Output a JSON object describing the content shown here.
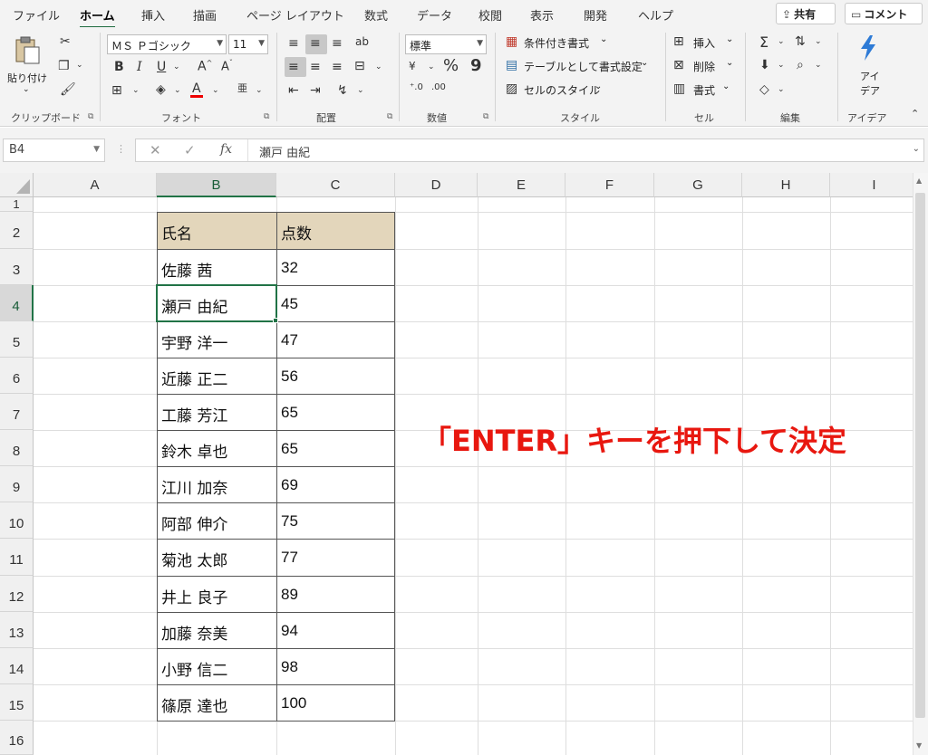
{
  "menu": {
    "tabs": [
      "ファイル",
      "ホーム",
      "挿入",
      "描画",
      "ページ レイアウト",
      "数式",
      "データ",
      "校閲",
      "表示",
      "開発",
      "ヘルプ"
    ],
    "active_tab": "ホーム",
    "share_label": "共有",
    "comment_label": "コメント"
  },
  "ribbon": {
    "clipboard": {
      "paste_label": "貼り付け",
      "group_label": "クリップボード"
    },
    "font": {
      "font_name": "ＭＳ Ｐゴシック",
      "font_size": "11",
      "group_label": "フォント",
      "bold": "B",
      "italic": "I",
      "underline": "U"
    },
    "alignment": {
      "group_label": "配置"
    },
    "number": {
      "format": "標準",
      "group_label": "数値",
      "percent": "%",
      "comma": "9"
    },
    "styles": {
      "conditional": "条件付き書式",
      "as_table": "テーブルとして書式設定",
      "cell_styles": "セルのスタイル",
      "group_label": "スタイル"
    },
    "cells": {
      "insert": "挿入",
      "delete": "削除",
      "format": "書式",
      "group_label": "セル"
    },
    "editing": {
      "group_label": "編集"
    },
    "ideas": {
      "label_line1": "アイ",
      "label_line2": "デア",
      "group_label": "アイデア"
    }
  },
  "formula_bar": {
    "name_box": "B4",
    "fx_label": "fx",
    "content": "瀬戸 由紀"
  },
  "sheet": {
    "columns": [
      "A",
      "B",
      "C",
      "D",
      "E",
      "F",
      "G",
      "H",
      "I"
    ],
    "rows": [
      "1",
      "2",
      "3",
      "4",
      "5",
      "6",
      "7",
      "8",
      "9",
      "10",
      "11",
      "12",
      "13",
      "14",
      "15",
      "16"
    ],
    "selected_column": "B",
    "selected_row": "4",
    "active_cell": "B4",
    "table": {
      "header": [
        "氏名",
        "点数"
      ],
      "rows": [
        [
          "佐藤 茜",
          "32"
        ],
        [
          "瀬戸 由紀",
          "45"
        ],
        [
          "宇野 洋一",
          "47"
        ],
        [
          "近藤 正二",
          "56"
        ],
        [
          "工藤 芳江",
          "65"
        ],
        [
          "鈴木 卓也",
          "65"
        ],
        [
          "江川 加奈",
          "69"
        ],
        [
          "阿部 伸介",
          "75"
        ],
        [
          "菊池 太郎",
          "77"
        ],
        [
          "井上 良子",
          "89"
        ],
        [
          "加藤 奈美",
          "94"
        ],
        [
          "小野 信二",
          "98"
        ],
        [
          "篠原 達也",
          "100"
        ]
      ]
    }
  },
  "annotation": "「ENTER」キーを押下して決定",
  "colors": {
    "accent": "#217346",
    "table_header_fill": "#e3d6bb",
    "annotation": "#e8170f"
  }
}
